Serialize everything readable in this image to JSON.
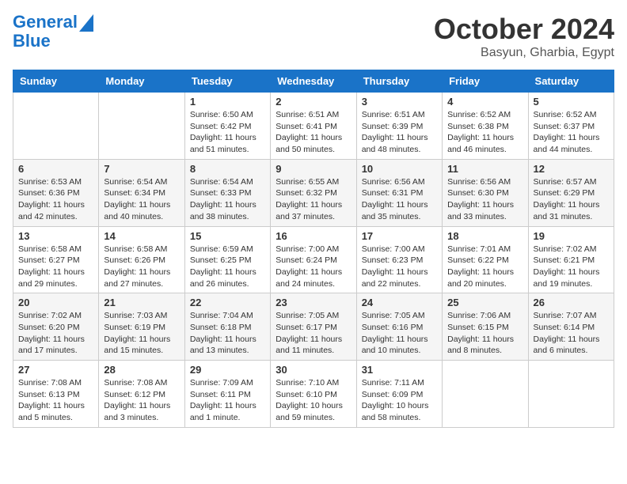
{
  "header": {
    "logo_line1": "General",
    "logo_line2": "Blue",
    "month_title": "October 2024",
    "location": "Basyun, Gharbia, Egypt"
  },
  "days_of_week": [
    "Sunday",
    "Monday",
    "Tuesday",
    "Wednesday",
    "Thursday",
    "Friday",
    "Saturday"
  ],
  "weeks": [
    [
      {
        "day": "",
        "sunrise": "",
        "sunset": "",
        "daylight": ""
      },
      {
        "day": "",
        "sunrise": "",
        "sunset": "",
        "daylight": ""
      },
      {
        "day": "1",
        "sunrise": "Sunrise: 6:50 AM",
        "sunset": "Sunset: 6:42 PM",
        "daylight": "Daylight: 11 hours and 51 minutes."
      },
      {
        "day": "2",
        "sunrise": "Sunrise: 6:51 AM",
        "sunset": "Sunset: 6:41 PM",
        "daylight": "Daylight: 11 hours and 50 minutes."
      },
      {
        "day": "3",
        "sunrise": "Sunrise: 6:51 AM",
        "sunset": "Sunset: 6:39 PM",
        "daylight": "Daylight: 11 hours and 48 minutes."
      },
      {
        "day": "4",
        "sunrise": "Sunrise: 6:52 AM",
        "sunset": "Sunset: 6:38 PM",
        "daylight": "Daylight: 11 hours and 46 minutes."
      },
      {
        "day": "5",
        "sunrise": "Sunrise: 6:52 AM",
        "sunset": "Sunset: 6:37 PM",
        "daylight": "Daylight: 11 hours and 44 minutes."
      }
    ],
    [
      {
        "day": "6",
        "sunrise": "Sunrise: 6:53 AM",
        "sunset": "Sunset: 6:36 PM",
        "daylight": "Daylight: 11 hours and 42 minutes."
      },
      {
        "day": "7",
        "sunrise": "Sunrise: 6:54 AM",
        "sunset": "Sunset: 6:34 PM",
        "daylight": "Daylight: 11 hours and 40 minutes."
      },
      {
        "day": "8",
        "sunrise": "Sunrise: 6:54 AM",
        "sunset": "Sunset: 6:33 PM",
        "daylight": "Daylight: 11 hours and 38 minutes."
      },
      {
        "day": "9",
        "sunrise": "Sunrise: 6:55 AM",
        "sunset": "Sunset: 6:32 PM",
        "daylight": "Daylight: 11 hours and 37 minutes."
      },
      {
        "day": "10",
        "sunrise": "Sunrise: 6:56 AM",
        "sunset": "Sunset: 6:31 PM",
        "daylight": "Daylight: 11 hours and 35 minutes."
      },
      {
        "day": "11",
        "sunrise": "Sunrise: 6:56 AM",
        "sunset": "Sunset: 6:30 PM",
        "daylight": "Daylight: 11 hours and 33 minutes."
      },
      {
        "day": "12",
        "sunrise": "Sunrise: 6:57 AM",
        "sunset": "Sunset: 6:29 PM",
        "daylight": "Daylight: 11 hours and 31 minutes."
      }
    ],
    [
      {
        "day": "13",
        "sunrise": "Sunrise: 6:58 AM",
        "sunset": "Sunset: 6:27 PM",
        "daylight": "Daylight: 11 hours and 29 minutes."
      },
      {
        "day": "14",
        "sunrise": "Sunrise: 6:58 AM",
        "sunset": "Sunset: 6:26 PM",
        "daylight": "Daylight: 11 hours and 27 minutes."
      },
      {
        "day": "15",
        "sunrise": "Sunrise: 6:59 AM",
        "sunset": "Sunset: 6:25 PM",
        "daylight": "Daylight: 11 hours and 26 minutes."
      },
      {
        "day": "16",
        "sunrise": "Sunrise: 7:00 AM",
        "sunset": "Sunset: 6:24 PM",
        "daylight": "Daylight: 11 hours and 24 minutes."
      },
      {
        "day": "17",
        "sunrise": "Sunrise: 7:00 AM",
        "sunset": "Sunset: 6:23 PM",
        "daylight": "Daylight: 11 hours and 22 minutes."
      },
      {
        "day": "18",
        "sunrise": "Sunrise: 7:01 AM",
        "sunset": "Sunset: 6:22 PM",
        "daylight": "Daylight: 11 hours and 20 minutes."
      },
      {
        "day": "19",
        "sunrise": "Sunrise: 7:02 AM",
        "sunset": "Sunset: 6:21 PM",
        "daylight": "Daylight: 11 hours and 19 minutes."
      }
    ],
    [
      {
        "day": "20",
        "sunrise": "Sunrise: 7:02 AM",
        "sunset": "Sunset: 6:20 PM",
        "daylight": "Daylight: 11 hours and 17 minutes."
      },
      {
        "day": "21",
        "sunrise": "Sunrise: 7:03 AM",
        "sunset": "Sunset: 6:19 PM",
        "daylight": "Daylight: 11 hours and 15 minutes."
      },
      {
        "day": "22",
        "sunrise": "Sunrise: 7:04 AM",
        "sunset": "Sunset: 6:18 PM",
        "daylight": "Daylight: 11 hours and 13 minutes."
      },
      {
        "day": "23",
        "sunrise": "Sunrise: 7:05 AM",
        "sunset": "Sunset: 6:17 PM",
        "daylight": "Daylight: 11 hours and 11 minutes."
      },
      {
        "day": "24",
        "sunrise": "Sunrise: 7:05 AM",
        "sunset": "Sunset: 6:16 PM",
        "daylight": "Daylight: 11 hours and 10 minutes."
      },
      {
        "day": "25",
        "sunrise": "Sunrise: 7:06 AM",
        "sunset": "Sunset: 6:15 PM",
        "daylight": "Daylight: 11 hours and 8 minutes."
      },
      {
        "day": "26",
        "sunrise": "Sunrise: 7:07 AM",
        "sunset": "Sunset: 6:14 PM",
        "daylight": "Daylight: 11 hours and 6 minutes."
      }
    ],
    [
      {
        "day": "27",
        "sunrise": "Sunrise: 7:08 AM",
        "sunset": "Sunset: 6:13 PM",
        "daylight": "Daylight: 11 hours and 5 minutes."
      },
      {
        "day": "28",
        "sunrise": "Sunrise: 7:08 AM",
        "sunset": "Sunset: 6:12 PM",
        "daylight": "Daylight: 11 hours and 3 minutes."
      },
      {
        "day": "29",
        "sunrise": "Sunrise: 7:09 AM",
        "sunset": "Sunset: 6:11 PM",
        "daylight": "Daylight: 11 hours and 1 minute."
      },
      {
        "day": "30",
        "sunrise": "Sunrise: 7:10 AM",
        "sunset": "Sunset: 6:10 PM",
        "daylight": "Daylight: 10 hours and 59 minutes."
      },
      {
        "day": "31",
        "sunrise": "Sunrise: 7:11 AM",
        "sunset": "Sunset: 6:09 PM",
        "daylight": "Daylight: 10 hours and 58 minutes."
      },
      {
        "day": "",
        "sunrise": "",
        "sunset": "",
        "daylight": ""
      },
      {
        "day": "",
        "sunrise": "",
        "sunset": "",
        "daylight": ""
      }
    ]
  ]
}
